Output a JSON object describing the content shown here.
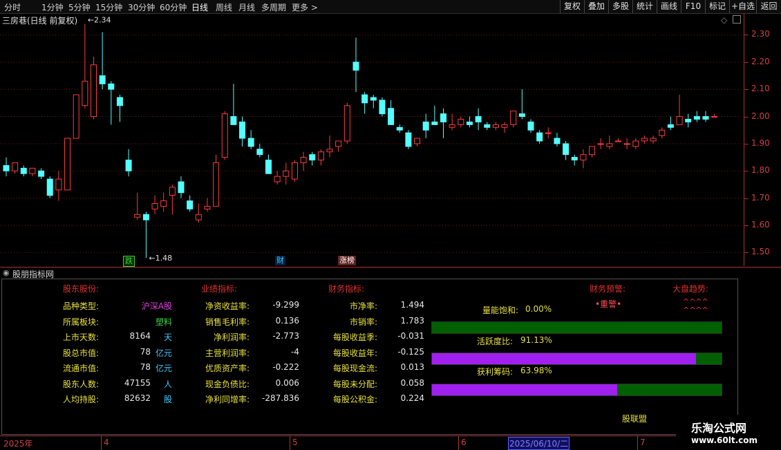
{
  "toolbar": {
    "periods": [
      "分时",
      "1分钟",
      "5分钟",
      "15分钟",
      "30分钟",
      "60分钟",
      "日线",
      "周线",
      "月线",
      "多周期",
      "更多 >"
    ],
    "active_period": "日线",
    "right_buttons": [
      "复权",
      "叠加",
      "多股",
      "统计",
      "画线",
      "F10",
      "标记",
      "+自选",
      "返回"
    ]
  },
  "chart": {
    "title": "三房巷(日线 前复权)",
    "high_label": "2.34",
    "low_label": "1.48",
    "y_ticks": [
      "2.30",
      "2.20",
      "2.10",
      "2.00",
      "1.90",
      "1.80",
      "1.70",
      "1.60",
      "1.50"
    ],
    "tags": [
      {
        "text": "跌",
        "color": "#40d040"
      },
      {
        "text": "财",
        "color": "#40c8ff"
      },
      {
        "text": "涨榜",
        "color": "#e8e8e8"
      }
    ],
    "colors": {
      "up": "#ff3c3c",
      "down": "#54ffff",
      "grid": "#7a1a1a"
    }
  },
  "chart_data": {
    "type": "candlestick",
    "ylim": [
      1.45,
      2.38
    ],
    "candles": [
      [
        1.82,
        1.85,
        1.78,
        1.8
      ],
      [
        1.8,
        1.83,
        1.79,
        1.83
      ],
      [
        1.81,
        1.82,
        1.78,
        1.79
      ],
      [
        1.79,
        1.81,
        1.78,
        1.81
      ],
      [
        1.8,
        1.81,
        1.77,
        1.78
      ],
      [
        1.77,
        1.78,
        1.7,
        1.71
      ],
      [
        1.73,
        1.8,
        1.69,
        1.77
      ],
      [
        1.73,
        1.91,
        1.73,
        1.92
      ],
      [
        1.92,
        2.08,
        1.92,
        2.08
      ],
      [
        2.04,
        2.34,
        2.03,
        2.13
      ],
      [
        2.0,
        2.22,
        1.99,
        2.19
      ],
      [
        2.15,
        2.31,
        2.1,
        2.12
      ],
      [
        2.12,
        2.13,
        1.97,
        2.1
      ],
      [
        2.07,
        2.08,
        1.98,
        2.04
      ],
      [
        1.84,
        1.88,
        1.78,
        1.8
      ],
      [
        1.63,
        1.72,
        1.62,
        1.64
      ],
      [
        1.64,
        1.65,
        1.48,
        1.62
      ],
      [
        1.66,
        1.71,
        1.64,
        1.68
      ],
      [
        1.67,
        1.72,
        1.65,
        1.69
      ],
      [
        1.71,
        1.75,
        1.64,
        1.74
      ],
      [
        1.76,
        1.78,
        1.7,
        1.72
      ],
      [
        1.69,
        1.71,
        1.65,
        1.66
      ],
      [
        1.62,
        1.68,
        1.61,
        1.64
      ],
      [
        1.66,
        1.7,
        1.65,
        1.67
      ],
      [
        1.67,
        1.86,
        1.67,
        1.83
      ],
      [
        1.85,
        2.02,
        1.84,
        2.01
      ],
      [
        2.0,
        2.12,
        1.97,
        1.97
      ],
      [
        1.98,
        2.0,
        1.89,
        1.92
      ],
      [
        1.92,
        1.95,
        1.88,
        1.89
      ],
      [
        1.88,
        1.9,
        1.85,
        1.86
      ],
      [
        1.84,
        1.86,
        1.79,
        1.79
      ],
      [
        1.76,
        1.8,
        1.75,
        1.78
      ],
      [
        1.78,
        1.83,
        1.75,
        1.8
      ],
      [
        1.77,
        1.84,
        1.76,
        1.83
      ],
      [
        1.83,
        1.87,
        1.8,
        1.85
      ],
      [
        1.86,
        1.87,
        1.82,
        1.84
      ],
      [
        1.84,
        1.88,
        1.82,
        1.87
      ],
      [
        1.87,
        1.93,
        1.85,
        1.88
      ],
      [
        1.89,
        1.91,
        1.87,
        1.91
      ],
      [
        1.91,
        2.05,
        1.9,
        2.04
      ],
      [
        2.2,
        2.29,
        2.09,
        2.17
      ],
      [
        2.08,
        2.09,
        2.01,
        2.05
      ],
      [
        2.07,
        2.08,
        2.03,
        2.06
      ],
      [
        2.06,
        2.07,
        2.0,
        2.01
      ],
      [
        2.03,
        2.06,
        1.98,
        1.97
      ],
      [
        1.96,
        1.97,
        1.94,
        1.95
      ],
      [
        1.94,
        1.95,
        1.88,
        1.89
      ],
      [
        1.9,
        1.92,
        1.89,
        1.92
      ],
      [
        1.98,
        2.01,
        1.92,
        1.95
      ],
      [
        1.98,
        2.04,
        1.97,
        1.97
      ],
      [
        2.01,
        2.03,
        1.92,
        1.98
      ],
      [
        1.96,
        2.01,
        1.95,
        1.97
      ],
      [
        1.97,
        2.0,
        1.96,
        1.99
      ],
      [
        1.98,
        2.0,
        1.96,
        1.97
      ],
      [
        2.0,
        2.03,
        1.95,
        1.98
      ],
      [
        1.97,
        1.98,
        1.95,
        1.96
      ],
      [
        1.96,
        1.98,
        1.95,
        1.97
      ],
      [
        1.96,
        1.98,
        1.94,
        1.97
      ],
      [
        1.97,
        2.01,
        1.96,
        2.02
      ],
      [
        2.01,
        2.1,
        1.99,
        2.0
      ],
      [
        1.98,
        1.99,
        1.94,
        1.95
      ],
      [
        1.94,
        1.95,
        1.9,
        1.91
      ],
      [
        1.94,
        1.96,
        1.92,
        1.94
      ],
      [
        1.92,
        1.94,
        1.89,
        1.9
      ],
      [
        1.9,
        1.91,
        1.84,
        1.86
      ],
      [
        1.85,
        1.86,
        1.82,
        1.84
      ],
      [
        1.84,
        1.88,
        1.81,
        1.86
      ],
      [
        1.86,
        1.89,
        1.85,
        1.89
      ],
      [
        1.9,
        1.92,
        1.88,
        1.9
      ],
      [
        1.89,
        1.93,
        1.88,
        1.9
      ],
      [
        1.91,
        1.92,
        1.91,
        1.91
      ],
      [
        1.9,
        1.92,
        1.88,
        1.9
      ],
      [
        1.89,
        1.92,
        1.88,
        1.91
      ],
      [
        1.91,
        1.93,
        1.9,
        1.92
      ],
      [
        1.91,
        1.93,
        1.9,
        1.92
      ],
      [
        1.93,
        1.96,
        1.92,
        1.95
      ],
      [
        1.97,
        2.0,
        1.95,
        1.96
      ],
      [
        1.97,
        2.08,
        1.97,
        2.0
      ],
      [
        1.99,
        2.01,
        1.96,
        1.98
      ],
      [
        2.0,
        2.02,
        1.98,
        1.99
      ],
      [
        2.0,
        2.02,
        1.98,
        1.99
      ],
      [
        2.0,
        2.01,
        2.0,
        2.0
      ]
    ]
  },
  "panel": {
    "header_title": "股朋指标网",
    "sections": {
      "holder": "股东股份:",
      "performance": "业绩指标:",
      "finance": "财务指标:",
      "warning": "财务预警:",
      "market": "大盘趋势:"
    },
    "holder_rows": [
      {
        "label": "品种类型:",
        "value": "沪深A股",
        "unit": ""
      },
      {
        "label": "所属板块:",
        "value": "塑料",
        "unit": ""
      },
      {
        "label": "上市天数:",
        "value": "8164",
        "unit": "天"
      },
      {
        "label": "股总市值:",
        "value": "78",
        "unit": "亿元"
      },
      {
        "label": "流通市值:",
        "value": "78",
        "unit": "亿元"
      },
      {
        "label": "股东人数:",
        "value": "47155",
        "unit": "人"
      },
      {
        "label": "人均持股:",
        "value": "82632",
        "unit": "股"
      }
    ],
    "performance_rows": [
      {
        "label": "净资收益率:",
        "value": "-9.299"
      },
      {
        "label": "销售毛利率:",
        "value": "0.136"
      },
      {
        "label": "净利润率:",
        "value": "-2.773"
      },
      {
        "label": "主营利润率:",
        "value": "-4"
      },
      {
        "label": "优质资产率:",
        "value": "-0.222"
      },
      {
        "label": "现金负债比:",
        "value": "0.006"
      },
      {
        "label": "净利同增率:",
        "value": "-287.836"
      }
    ],
    "finance_rows": [
      {
        "label": "市净率:",
        "value": "1.494"
      },
      {
        "label": "市销率:",
        "value": "1.783"
      },
      {
        "label": "每股收益季:",
        "value": "-0.031"
      },
      {
        "label": "每股收益年:",
        "value": "-0.125"
      },
      {
        "label": "每股现金流:",
        "value": "0.013"
      },
      {
        "label": "每股未分配:",
        "value": "0.058"
      },
      {
        "label": "每股公积金:",
        "value": "0.224"
      }
    ],
    "warning_value": "•重警•",
    "market_value_1": "^^^^",
    "market_value_2": "^^^^",
    "bars": [
      {
        "label": "量能饱和:",
        "value": "0.00%",
        "fraction": 0.0
      },
      {
        "label": "活跃度比:",
        "value": "91.13%",
        "fraction": 0.9113
      },
      {
        "label": "获利筹码:",
        "value": "63.98%",
        "fraction": 0.6398
      }
    ],
    "footer": "股联盟"
  },
  "datebar": {
    "items": [
      "2025年",
      "4",
      "5",
      "6",
      "7"
    ],
    "cursor": "2025/06/10/二"
  },
  "watermark": {
    "name": "乐淘公式网",
    "url": "www.60lt.com"
  }
}
